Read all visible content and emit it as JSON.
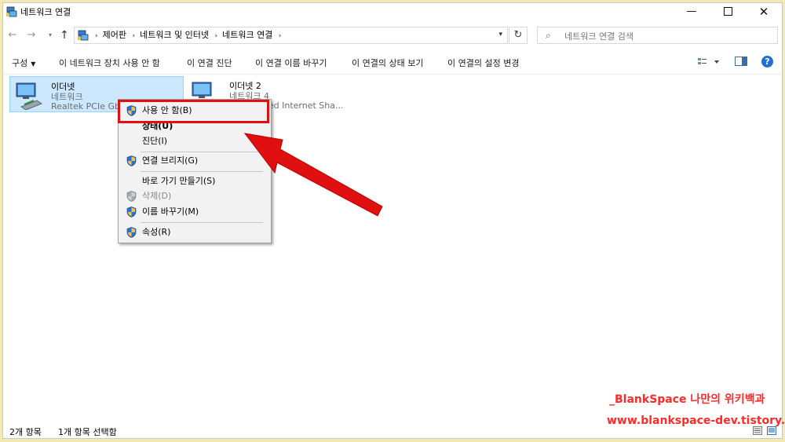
{
  "window": {
    "title": "네트워크 연결",
    "minimize_glyph": "—",
    "close_glyph": "✕"
  },
  "address": {
    "crumbs": [
      "제어판",
      "네트워크 및 인터넷",
      "네트워크 연결"
    ],
    "separator": "›",
    "search_placeholder": "네트워크 연결 검색"
  },
  "toolbar": {
    "organize": "구성",
    "commands": [
      "이 네트워크 장치 사용 안 함",
      "이 연결 진단",
      "이 연결 이름 바꾸기",
      "이 연결의 상태 보기",
      "이 연결의 설정 변경"
    ],
    "help": "?"
  },
  "items": [
    {
      "name": "이더넷",
      "type": "네트워크",
      "adapter": "Realtek PCIe GbE",
      "selected": true
    },
    {
      "name": "이더넷 2",
      "type": "네트워크 4",
      "adapter": "NDIS based Internet Sha...",
      "selected": false
    }
  ],
  "context_menu": {
    "items": [
      {
        "label": "사용 안 함(B)",
        "shield": true,
        "bold": false,
        "disabled": false
      },
      {
        "label": "상태(U)",
        "shield": false,
        "bold": true,
        "disabled": false
      },
      {
        "label": "진단(I)",
        "shield": false,
        "bold": false,
        "disabled": false
      },
      {
        "label": "연결 브리지(G)",
        "shield": true,
        "bold": false,
        "disabled": false
      },
      {
        "label": "바로 가기 만들기(S)",
        "shield": false,
        "bold": false,
        "disabled": false
      },
      {
        "label": "삭제(D)",
        "shield": true,
        "bold": false,
        "disabled": true
      },
      {
        "label": "이름 바꾸기(M)",
        "shield": true,
        "bold": false,
        "disabled": false
      },
      {
        "label": "속성(R)",
        "shield": true,
        "bold": false,
        "disabled": false
      }
    ]
  },
  "annotation": {
    "highlight_color": "#e01010",
    "arrow_color": "#e01010"
  },
  "status": {
    "count": "2개 항목",
    "selected": "1개 항목 선택함"
  },
  "watermark": {
    "line1": "_BlankSpace 나만의 위키백과",
    "line2": "www.blankspace-dev.tistory.com",
    "color": "#ff2a2a"
  },
  "colors": {
    "border_bg": "#f3eab3",
    "selection_bg": "#cce8ff",
    "selection_border": "#99d1ff",
    "help_blue": "#1e6fd0"
  }
}
